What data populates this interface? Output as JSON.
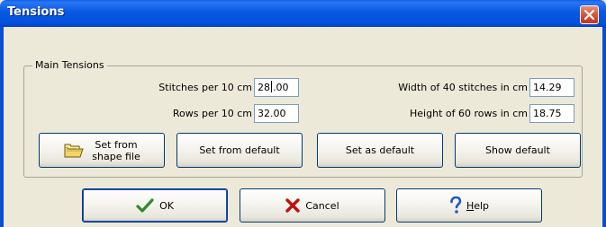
{
  "window": {
    "title": "Tensions",
    "close_icon": "close-icon"
  },
  "group": {
    "label": "Main Tensions"
  },
  "fields": {
    "stitches_label": "Stitches per 10 cm",
    "stitches_value_before_caret": "28",
    "stitches_value_after_caret": ".00",
    "rows_label": "Rows per 10 cm",
    "rows_value": "32.00",
    "width_label": "Width of 40 stitches in cm",
    "width_value": "14.29",
    "height_label": "Height of 60 rows in cm",
    "height_value": "18.75"
  },
  "buttons": {
    "set_from_shape_line1": "Set from",
    "set_from_shape_line2": "shape file",
    "set_from_default": "Set from default",
    "set_as_default": "Set as default",
    "show_default": "Show default",
    "ok": "OK",
    "cancel": "Cancel",
    "help_underlined": "H",
    "help_rest": "elp"
  },
  "icons": {
    "folder": "folder-icon",
    "ok": "checkmark-icon",
    "cancel": "x-icon",
    "help": "question-mark-icon"
  },
  "colors": {
    "titlebar": "#0758E3",
    "dialog_bg": "#ECE9D8",
    "close_button": "#D8533A",
    "ok_check": "#2E8B2E",
    "cancel_x": "#C01010",
    "help_q": "#1E56C8"
  }
}
